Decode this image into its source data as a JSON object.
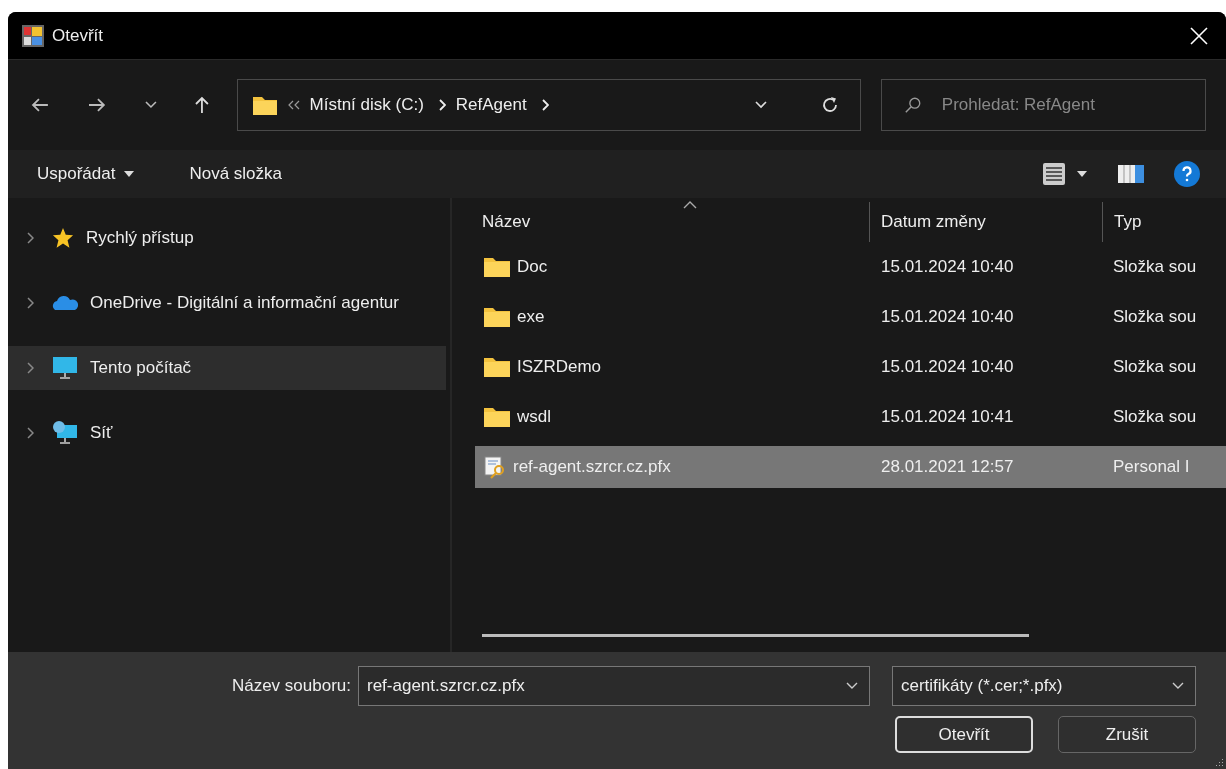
{
  "window": {
    "title": "Otevřít"
  },
  "address": {
    "crumbs": [
      "Místní disk (C:)",
      "RefAgent"
    ]
  },
  "search": {
    "placeholder": "Prohledat: RefAgent"
  },
  "toolbar": {
    "organize": "Uspořádat",
    "new_folder": "Nová složka"
  },
  "sidebar": {
    "items": [
      {
        "label": "Rychlý přístup",
        "kind": "star",
        "selected": false
      },
      {
        "label": "OneDrive - Digitální a informační agentur",
        "kind": "cloud",
        "selected": false
      },
      {
        "label": "Tento počítač",
        "kind": "computer",
        "selected": true
      },
      {
        "label": "Síť",
        "kind": "network",
        "selected": false
      }
    ]
  },
  "table": {
    "columns": [
      "Název",
      "Datum změny",
      "Typ"
    ],
    "rows": [
      {
        "name": "Doc",
        "date": "15.01.2024 10:40",
        "type": "Složka sou",
        "kind": "folder",
        "selected": false
      },
      {
        "name": "exe",
        "date": "15.01.2024 10:40",
        "type": "Složka sou",
        "kind": "folder",
        "selected": false
      },
      {
        "name": "ISZRDemo",
        "date": "15.01.2024 10:40",
        "type": "Složka sou",
        "kind": "folder",
        "selected": false
      },
      {
        "name": "wsdl",
        "date": "15.01.2024 10:41",
        "type": "Složka sou",
        "kind": "folder",
        "selected": false
      },
      {
        "name": "ref-agent.szrcr.cz.pfx",
        "date": "28.01.2021 12:57",
        "type": "Personal I",
        "kind": "certificate",
        "selected": true
      }
    ]
  },
  "footer": {
    "filename_label": "Název souboru:",
    "filename": "ref-agent.szrcr.cz.pfx",
    "filter": "certifikáty (*.cer;*.pfx)",
    "buttons": [
      "Otevřít",
      "Zrušit"
    ]
  }
}
